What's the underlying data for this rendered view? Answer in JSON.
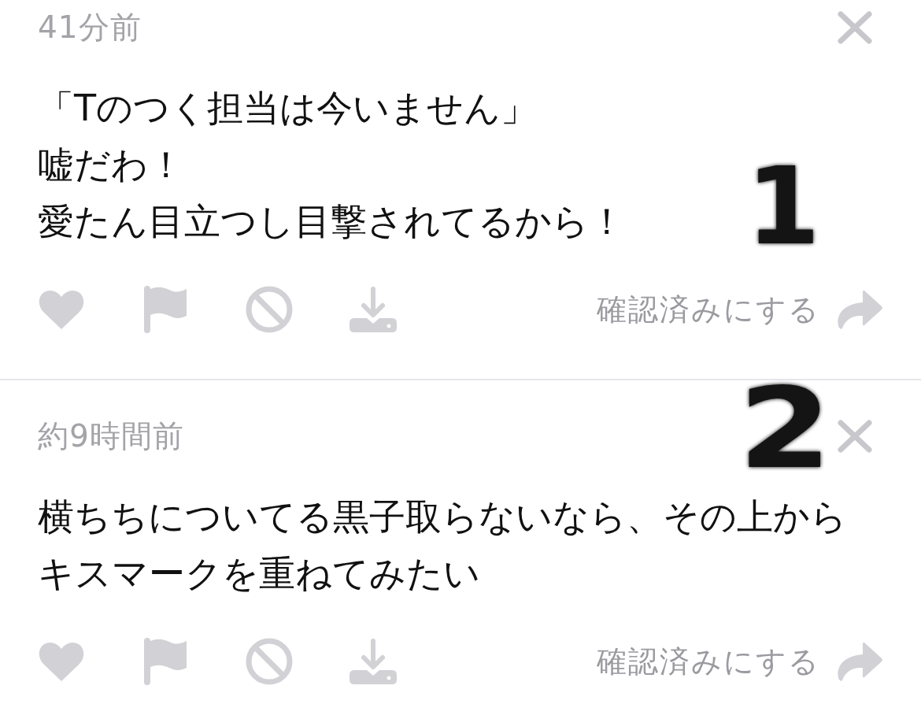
{
  "messages": [
    {
      "time": "41分前",
      "lines": [
        "「Tのつく担当は今いません」",
        "嘘だわ！",
        "愛たん目立つし目撃されてるから！"
      ],
      "mark_read": "確認済みにする",
      "annotation": "1"
    },
    {
      "time": "約9時間前",
      "lines": [
        "横ちちについてる黒子取らないなら、その上からキスマークを重ねてみたい"
      ],
      "mark_read": "確認済みにする",
      "annotation": "2"
    }
  ]
}
